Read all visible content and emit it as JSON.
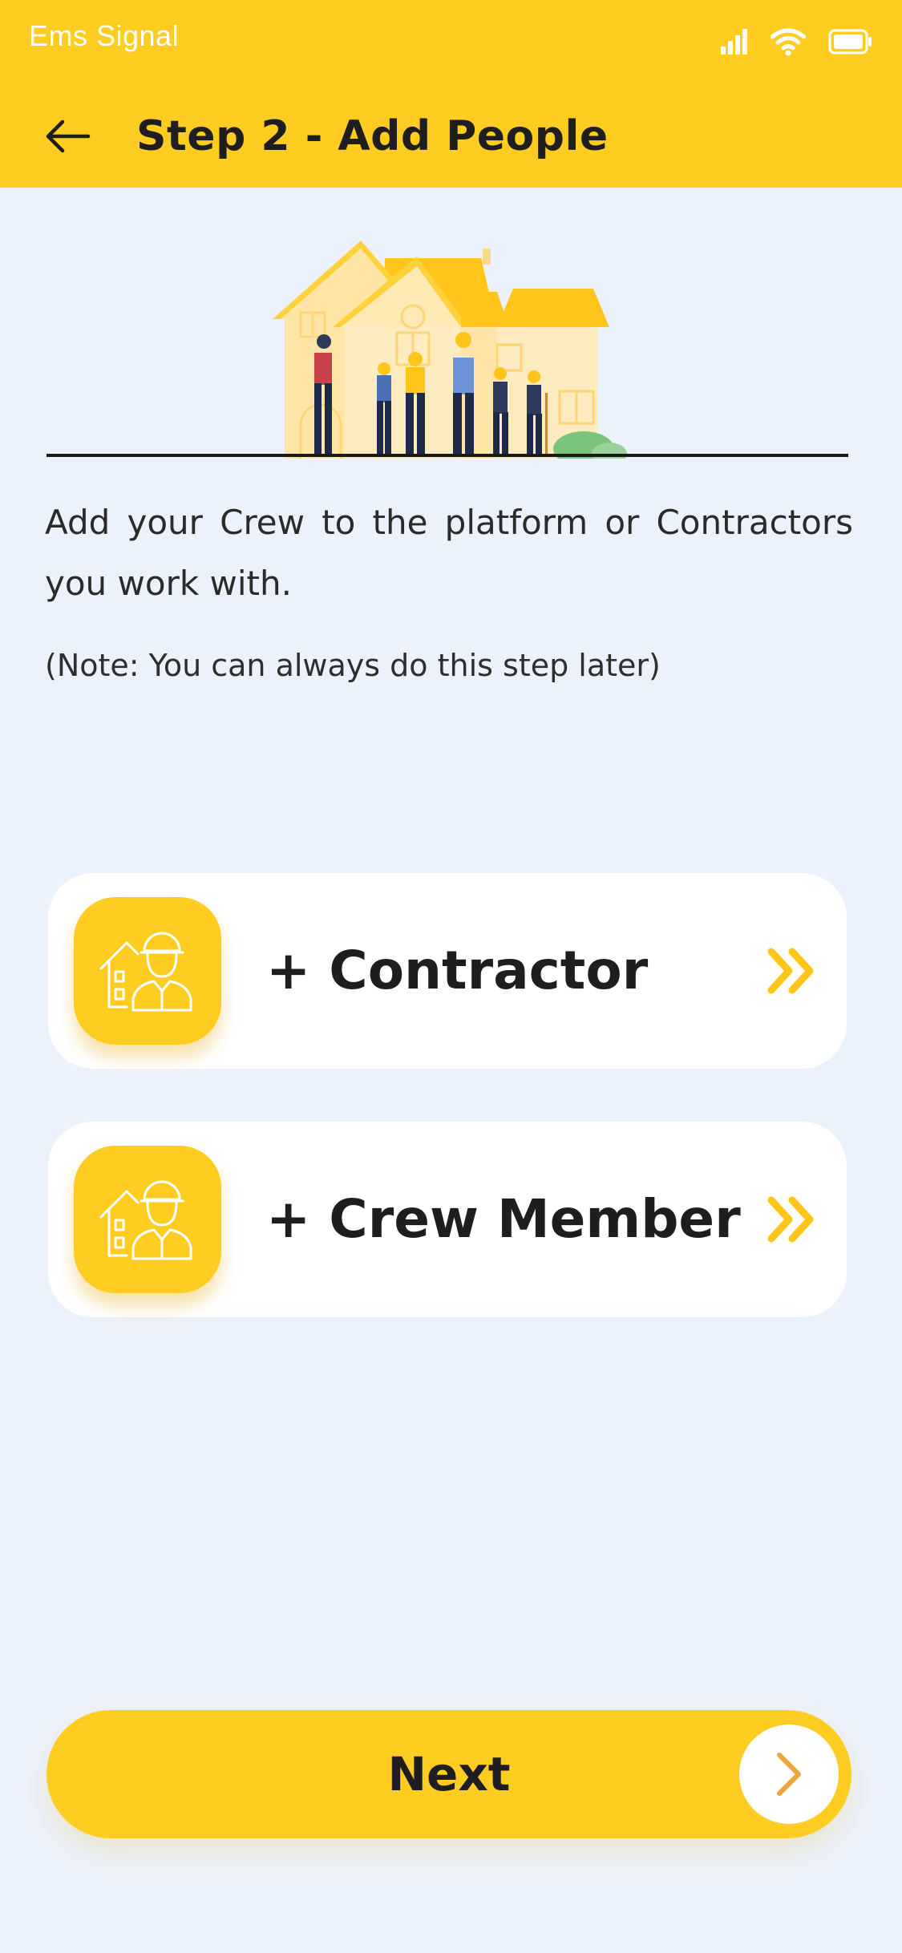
{
  "status_bar": {
    "carrier": "Ems Signal"
  },
  "header": {
    "title": "Step 2 - Add People"
  },
  "content": {
    "intro": "Add your Crew to the platform or Contractors you work with.",
    "note": "(Note: You can always do this step later)"
  },
  "options": [
    {
      "label": "+ Contractor"
    },
    {
      "label": "+ Crew Member"
    }
  ],
  "footer": {
    "next_label": "Next"
  },
  "colors": {
    "accent": "#FFCD22",
    "background": "#ECF2FB",
    "chevron": "#F0A53A"
  },
  "icons": [
    "back-arrow-icon",
    "cellular-signal-icon",
    "wifi-icon",
    "battery-icon",
    "contractor-house-icon",
    "double-chevron-right-icon",
    "chevron-right-icon"
  ]
}
